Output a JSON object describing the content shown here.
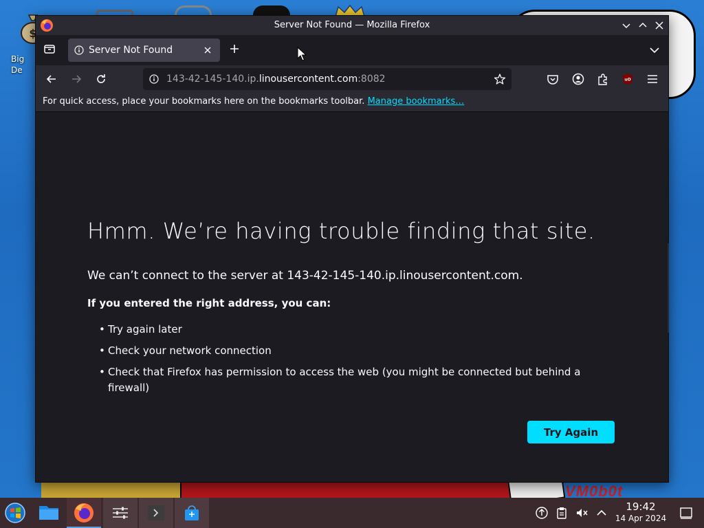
{
  "desktop": {
    "icon_label": "Big\nDe",
    "watermark": "VM0b0t"
  },
  "window": {
    "title": "Server Not Found — Mozilla Firefox"
  },
  "tabs": [
    {
      "title": "Server Not Found",
      "icon": "info-icon",
      "active": true
    }
  ],
  "urlbar": {
    "url_prefix": "143-42-145-140.ip.",
    "url_domain": "linousercontent.com",
    "url_port": ":8082"
  },
  "bookmarks_bar": {
    "message": "For quick access, place your bookmarks here on the bookmarks toolbar. ",
    "link": "Manage bookmarks…"
  },
  "error_page": {
    "title": "Hmm. We’re having trouble finding that site.",
    "description": "We can’t connect to the server at 143-42-145-140.ip.linousercontent.com.",
    "suggestions_heading": "If you entered the right address, you can:",
    "suggestions": [
      "Try again later",
      "Check your network connection",
      "Check that Firefox has permission to access the web (you might be connected but behind a firewall)"
    ],
    "try_again_label": "Try Again"
  },
  "taskbar": {
    "apps": [
      "start-menu",
      "file-manager",
      "firefox",
      "settings",
      "terminal",
      "app-store"
    ],
    "clock_time": "19:42",
    "clock_date": "14 Apr 2024"
  },
  "colors": {
    "accent": "#00ddff",
    "page_bg": "#1c1b22",
    "toolbar_bg": "#2b2a33",
    "tab_active_bg": "#42414d",
    "taskbar_bg": "#3a2a2e"
  }
}
